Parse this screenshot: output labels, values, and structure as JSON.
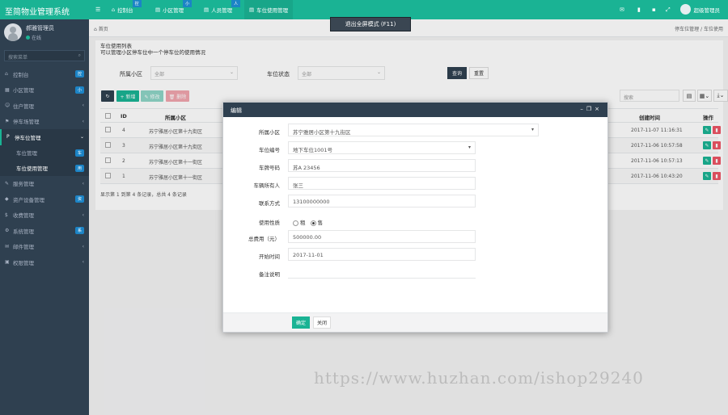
{
  "app": {
    "title": "至简物业管理系统"
  },
  "user": {
    "name": "郝雅管理员",
    "status": "在线",
    "top_name": "超级管理员"
  },
  "sidebar": {
    "search_placeholder": "搜索菜单",
    "items": [
      {
        "label": "控制台",
        "badge": "控"
      },
      {
        "label": "小区管理",
        "badge": "小"
      },
      {
        "label": "住户管理",
        "chevron": "‹"
      },
      {
        "label": "停车场管理",
        "chevron": "‹"
      },
      {
        "label": "停车位管理",
        "chevron": "‹"
      },
      {
        "label": "车位管理",
        "badge": "车"
      },
      {
        "label": "车位使用管理",
        "badge": "用"
      },
      {
        "label": "服务管理",
        "chevron": "‹"
      },
      {
        "label": "资产设备管理",
        "badge": "资"
      },
      {
        "label": "收费管理",
        "chevron": "‹"
      },
      {
        "label": "系统管理",
        "badge": "系"
      },
      {
        "label": "邮件管理",
        "chevron": "‹"
      },
      {
        "label": "权限管理",
        "chevron": "‹"
      }
    ]
  },
  "topbar": {
    "tabs": [
      {
        "label": "控制台",
        "badge": "控"
      },
      {
        "label": "小区管理",
        "badge": "小"
      },
      {
        "label": "人员管理",
        "badge": "人"
      },
      {
        "label": "车位使用管理",
        "badge": ""
      }
    ]
  },
  "breadcrumb": {
    "home": "首页",
    "right1": "停车位管理",
    "right2": "车位使用"
  },
  "fullscreen_hint": "退出全屏模式 (F11)",
  "panel": {
    "title": "车位使用列表",
    "subtitle": "可以管理小区停车位中一个停车位的使用情况",
    "filter_community_label": "所属小区",
    "filter_community_value": "全部",
    "filter_space_label": "车位状态",
    "filter_space_value": "全部",
    "query_btn": "查询",
    "reset_btn": "重置",
    "add_btn": "+ 新增",
    "edit_btn": "✎ 修改",
    "del_btn": "🗑 删除",
    "search_placeholder": "搜索"
  },
  "table": {
    "headers": {
      "id": "ID",
      "community": "所属小区",
      "created": "创建时间",
      "action": "操作"
    },
    "rows": [
      {
        "id": "4",
        "community": "苏宁雅居小区第十九街区",
        "created": "2017-11-07 11:16:31"
      },
      {
        "id": "3",
        "community": "苏宁雅居小区第十九街区",
        "created": "2017-11-06 10:57:58"
      },
      {
        "id": "2",
        "community": "苏宁雅居小区第十一街区",
        "created": "2017-11-06 10:57:13"
      },
      {
        "id": "1",
        "community": "苏宁雅居小区第十一街区",
        "created": "2017-11-06 10:43:20"
      }
    ],
    "pager": "显示第 1 到第 4 条记录，总共 4 条记录"
  },
  "modal": {
    "title": "编辑",
    "fields": {
      "community_label": "所属小区",
      "community_value": "苏宁雅居小区第十九街区",
      "space_label": "车位编号",
      "space_value": "地下车位1001号",
      "plate_label": "车牌号码",
      "plate_value": "苏A 23456",
      "owner_label": "车辆所有人",
      "owner_value": "张三",
      "phone_label": "联系方式",
      "phone_value": "13100000000",
      "usage_label": "使用性质",
      "usage_opt1": "租",
      "usage_opt2": "售",
      "price_label": "总费用（元）",
      "price_value": "500000.00",
      "start_label": "开始时间",
      "start_value": "2017-11-01",
      "remark_label": "备注说明"
    },
    "ok_btn": "确定",
    "close_btn": "关闭"
  },
  "watermark": "https://www.huzhan.com/ishop29240"
}
